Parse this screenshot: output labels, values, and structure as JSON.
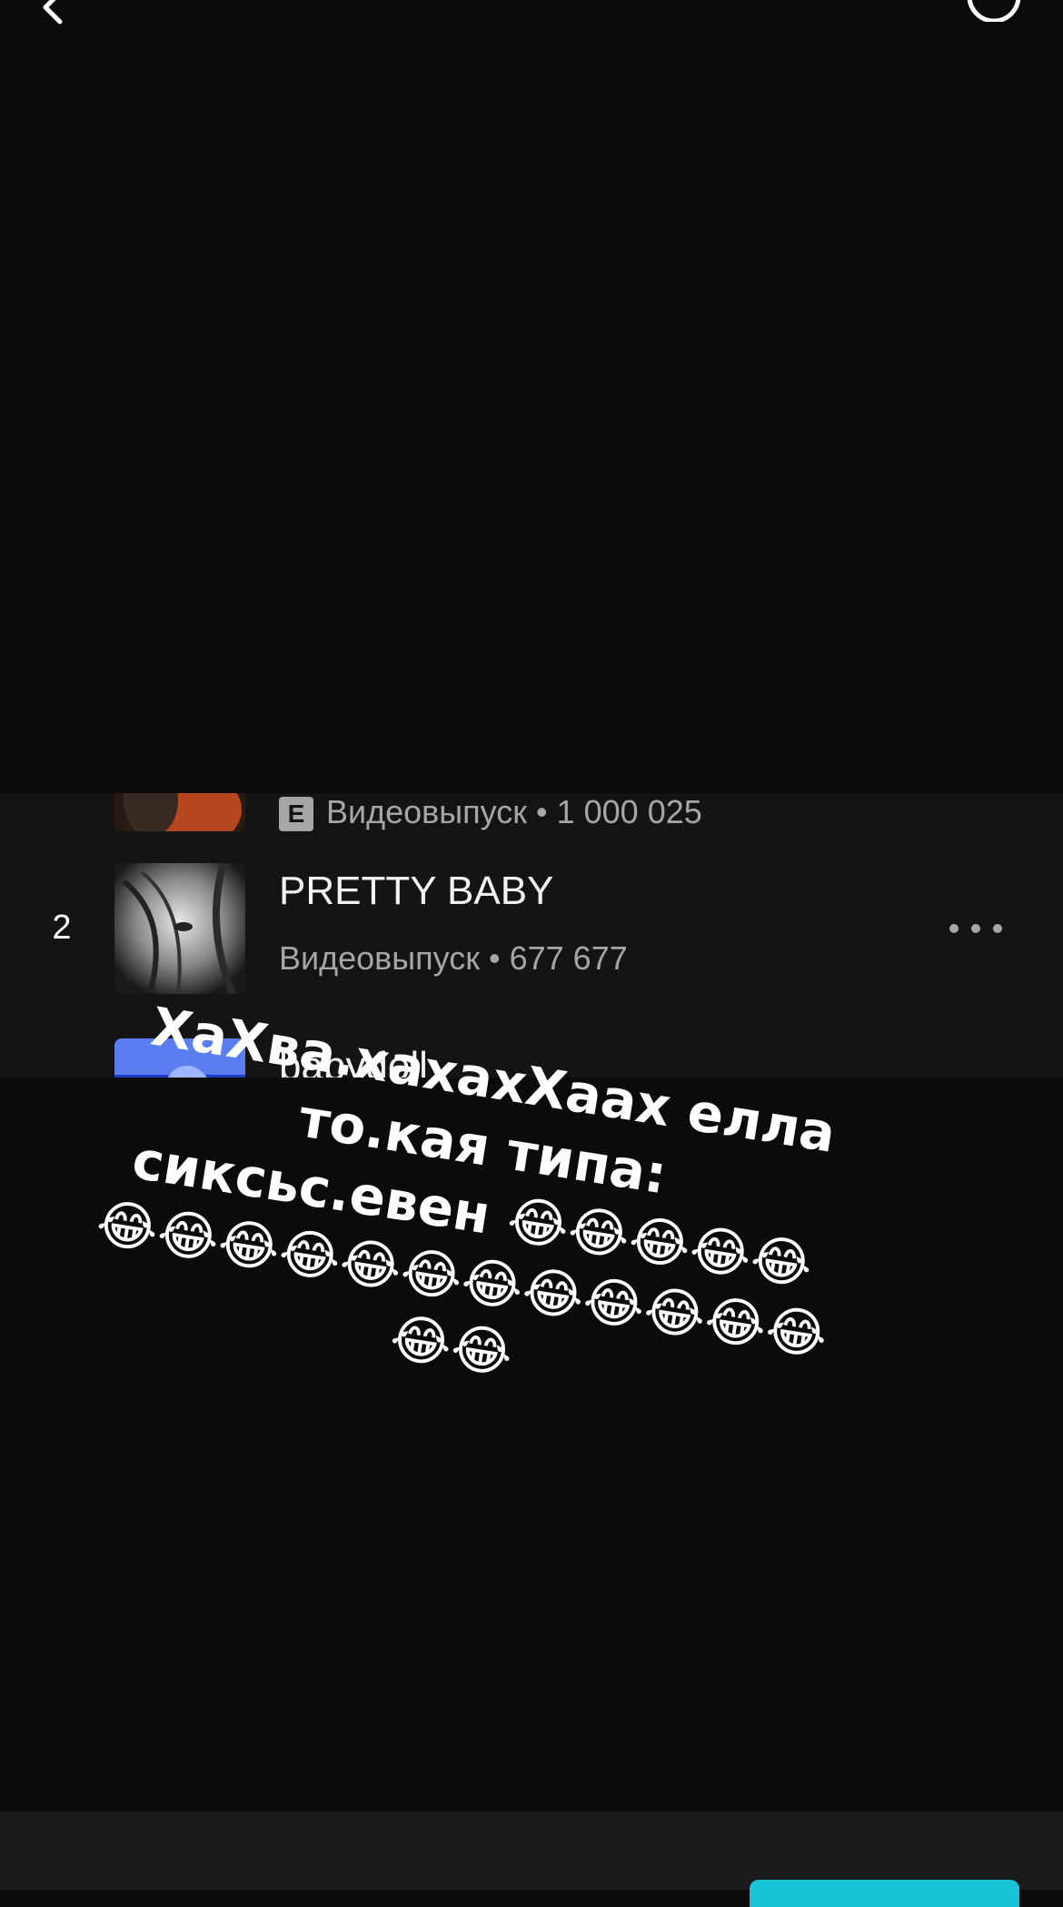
{
  "header": {
    "back_icon": "chevron-left-icon",
    "action_icon": "circle-icon"
  },
  "tracks": [
    {
      "index": "",
      "title": "",
      "explicit_badge": "E",
      "subtitle": "Видеовыпуск • 1 000 025"
    },
    {
      "index": "2",
      "title": "PRETTY BABY",
      "subtitle": "Видеовыпуск • 677 677",
      "more_icon": "more-horizontal-icon"
    },
    {
      "index": "",
      "title": "babydoll",
      "subtitle": ""
    }
  ],
  "caption": {
    "text": "ХаХва.хахахХаах елла то.кая типа: сиксьс.евен 😂😂😂😂😂😂😂😂😂😂😂😂😂😂😂😂😂😂😂"
  },
  "colors": {
    "background": "#0b0b0b",
    "panel": "#141414",
    "accent": "#19c3d8",
    "secondary_text": "#a6a6a6"
  }
}
